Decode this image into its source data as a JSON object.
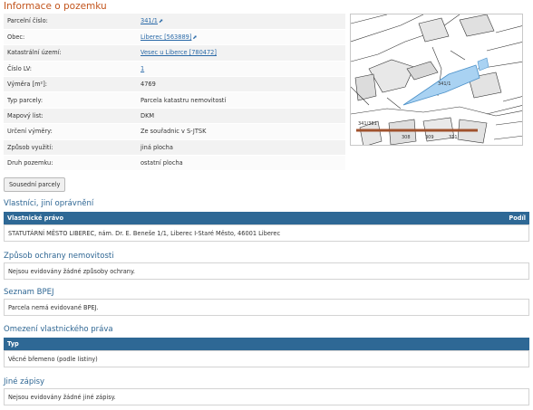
{
  "page": {
    "title": "Informace o pozemku"
  },
  "parcel_info": [
    {
      "label": "Parcelní číslo:",
      "value": "341/1",
      "link": true,
      "ext_icon": true
    },
    {
      "label": "Obec:",
      "value": "Liberec [563889]",
      "link": true,
      "ext_icon": true
    },
    {
      "label": "Katastrální území:",
      "value": "Vesec u Liberce [780472]",
      "link": true,
      "ext_icon": false
    },
    {
      "label": "Číslo LV:",
      "value": "1",
      "link": true,
      "ext_icon": false
    },
    {
      "label": "Výměra [m²]:",
      "value": "4769",
      "link": false,
      "ext_icon": false
    },
    {
      "label": "Typ parcely:",
      "value": "Parcela katastru nemovitostí",
      "link": false,
      "ext_icon": false
    },
    {
      "label": "Mapový list:",
      "value": "DKM",
      "link": false,
      "ext_icon": false
    },
    {
      "label": "Určení výměry:",
      "value": "Ze souřadnic v S-JTSK",
      "link": false,
      "ext_icon": false
    },
    {
      "label": "Způsob využití:",
      "value": "jiná plocha",
      "link": false,
      "ext_icon": false
    },
    {
      "label": "Druh pozemku:",
      "value": "ostatní plocha",
      "link": false,
      "ext_icon": false
    }
  ],
  "map": {
    "labels": [
      "341/1",
      "341/381",
      "308",
      "309",
      "311"
    ],
    "highlight_color": "#a9d2f2",
    "scale_color": "#a0522d"
  },
  "buttons": {
    "neighbors": "Sousední parcely"
  },
  "ownership": {
    "title": "Vlastníci, jiní oprávnění",
    "col_owner": "Vlastnické právo",
    "col_share": "Podíl",
    "owner": "STATUTÁRNÍ MĚSTO LIBEREC, nám. Dr. E. Beneše 1/1, Liberec I-Staré Město, 46001 Liberec"
  },
  "protection": {
    "title": "Způsob ochrany nemovitosti",
    "text": "Nejsou evidovány žádné způsoby ochrany."
  },
  "bpej": {
    "title": "Seznam BPEJ",
    "text": "Parcela nemá evidované BPEJ."
  },
  "restrictions": {
    "title": "Omezení vlastnického práva",
    "col_type": "Typ",
    "text": "Věcné břemeno (podle listiny)"
  },
  "other": {
    "title": "Jiné zápisy",
    "text": "Nejsou evidovány žádné jiné zápisy."
  }
}
